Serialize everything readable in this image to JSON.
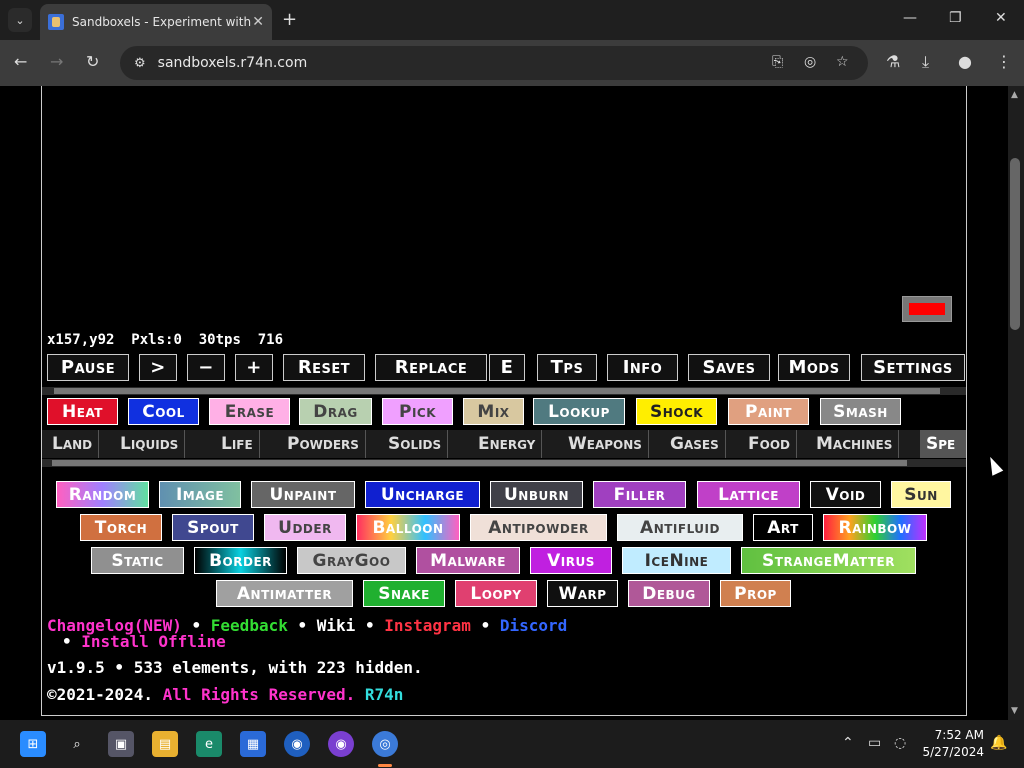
{
  "browser": {
    "tab_title": "Sandboxels - Experiment with P",
    "url": "sandboxels.r74n.com"
  },
  "stats": {
    "coords": "x157,y92",
    "pixels": "Pxls:0",
    "tps": "30tps",
    "count": "716"
  },
  "controls": [
    "Pause",
    ">",
    "−",
    "+",
    "Reset",
    "Replace",
    "E",
    "Tps",
    "Info",
    "Saves",
    "Mods",
    "Settings"
  ],
  "tools": [
    {
      "label": "Heat",
      "bg": "#e0102a",
      "fg": "#ffffff"
    },
    {
      "label": "Cool",
      "bg": "#1030e0",
      "fg": "#ffffff"
    },
    {
      "label": "Erase",
      "bg": "#ffb0e6",
      "fg": "#444444"
    },
    {
      "label": "Drag",
      "bg": "#b8d0b0",
      "fg": "#444444"
    },
    {
      "label": "Pick",
      "bg": "#f0a0ff",
      "fg": "#444444"
    },
    {
      "label": "Mix",
      "bg": "#d8c8a0",
      "fg": "#444444"
    },
    {
      "label": "Lookup",
      "bg": "#507a80",
      "fg": "#ffffff"
    },
    {
      "label": "Shock",
      "bg": "#ffee00",
      "fg": "#222222"
    },
    {
      "label": "Paint",
      "bg": "#e0a080",
      "fg": "#ffffff"
    },
    {
      "label": "Smash",
      "bg": "#888888",
      "fg": "#ffffff"
    }
  ],
  "categories": [
    "Land",
    "Liquids",
    "Life",
    "Powders",
    "Solids",
    "Energy",
    "Weapons",
    "Gases",
    "Food",
    "Machines",
    "Spe"
  ],
  "elements": {
    "row1": [
      {
        "label": "Random",
        "bg": "#c080ff",
        "fg": "#ffffff"
      },
      {
        "label": "Image",
        "bg": "#70a8a8",
        "fg": "#ffffff"
      },
      {
        "label": "Unpaint",
        "bg": "#666666",
        "fg": "#ffffff"
      },
      {
        "label": "Uncharge",
        "bg": "#1020d0",
        "fg": "#ffffff"
      },
      {
        "label": "Unburn",
        "bg": "#404048",
        "fg": "#ffffff"
      },
      {
        "label": "Filler",
        "bg": "#a040c0",
        "fg": "#ffffff"
      },
      {
        "label": "Lattice",
        "bg": "#c040c8",
        "fg": "#ffffff"
      },
      {
        "label": "Void",
        "bg": "#111111",
        "fg": "#ffffff"
      },
      {
        "label": "Sun",
        "bg": "#fff6a0",
        "fg": "#333333"
      }
    ],
    "row2": [
      {
        "label": "Torch",
        "bg": "#d07040",
        "fg": "#ffffff"
      },
      {
        "label": "Spout",
        "bg": "#404890",
        "fg": "#ffffff"
      },
      {
        "label": "Udder",
        "bg": "#f0b8f0",
        "fg": "#444444"
      },
      {
        "label": "Balloon",
        "bg": "#f03060",
        "fg": "#ffffff"
      },
      {
        "label": "Antipowder",
        "bg": "#f0e0d8",
        "fg": "#444444"
      },
      {
        "label": "Antifluid",
        "bg": "#e8eef0",
        "fg": "#444444"
      },
      {
        "label": "Art",
        "bg": "#000000",
        "fg": "#ffffff"
      },
      {
        "label": "Rainbow",
        "bg": "#ff3060",
        "fg": "#ffffff"
      }
    ],
    "row3": [
      {
        "label": "Static",
        "bg": "#909090",
        "fg": "#ffffff"
      },
      {
        "label": "Border",
        "bg": "#0a6a7a",
        "fg": "#ffffff"
      },
      {
        "label": "GrayGoo",
        "bg": "#c8c8c8",
        "fg": "#444444"
      },
      {
        "label": "Malware",
        "bg": "#b050a0",
        "fg": "#ffffff"
      },
      {
        "label": "Virus",
        "bg": "#c020e0",
        "fg": "#ffffff"
      },
      {
        "label": "IceNine",
        "bg": "#c0ecff",
        "fg": "#333333"
      },
      {
        "label": "StrangeMatter",
        "bg": "#80c840",
        "fg": "#ffffff"
      }
    ],
    "row4": [
      {
        "label": "Antimatter",
        "bg": "#a0a0a0",
        "fg": "#ffffff"
      },
      {
        "label": "Snake",
        "bg": "#20b030",
        "fg": "#ffffff"
      },
      {
        "label": "Loopy",
        "bg": "#e04070",
        "fg": "#ffffff"
      },
      {
        "label": "Warp",
        "bg": "#101010",
        "fg": "#ffffff"
      },
      {
        "label": "Debug",
        "bg": "#b05898",
        "fg": "#ffffff"
      },
      {
        "label": "Prop",
        "bg": "#d08050",
        "fg": "#ffffff"
      }
    ]
  },
  "footer": {
    "changelog": "Changelog(NEW)",
    "feedback": "Feedback",
    "wiki": "Wiki",
    "instagram": "Instagram",
    "discord": "Discord",
    "install": "Install Offline",
    "bullet": "•",
    "version": "v1.9.5 • 533 elements, with 223 hidden.",
    "copyright": "©2021-2024.",
    "rights": "All Rights Reserved.",
    "author": "R74n"
  },
  "clock": {
    "time": "7:52 AM",
    "date": "5/27/2024"
  }
}
